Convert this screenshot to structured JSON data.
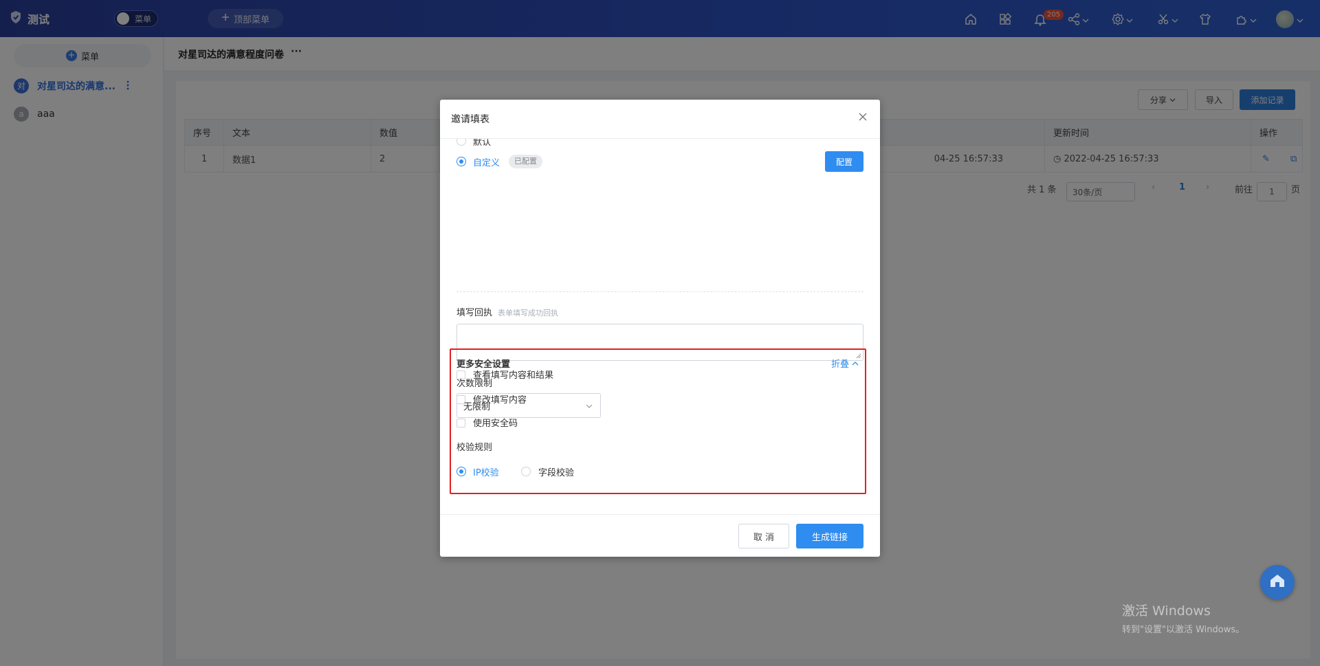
{
  "header": {
    "app_title": "测试",
    "menu_toggle_label": "菜单",
    "top_menu_label": "顶部菜单",
    "notification_count": "205"
  },
  "sidebar": {
    "add_menu_label": "菜单",
    "items": [
      {
        "avatar": "对",
        "label": "对星司达的满意...",
        "active": true
      },
      {
        "avatar": "a",
        "label": "aaa",
        "active": false
      }
    ]
  },
  "page": {
    "title": "对星司达的满意程度问卷"
  },
  "toolbar": {
    "share_label": "分享",
    "import_label": "导入",
    "add_record_label": "添加记录"
  },
  "table": {
    "columns": [
      "序号",
      "文本",
      "数值",
      "更新时间",
      "操作"
    ],
    "rows": [
      {
        "index": "1",
        "text": "数据1",
        "value": "2",
        "created_fragment": "04-25 16:57:33",
        "updated": "2022-04-25 16:57:33"
      }
    ]
  },
  "pagination": {
    "total": "共 1 条",
    "page_size": "30条/页",
    "current_page": "1",
    "goto_label": "前往",
    "goto_value": "1",
    "page_suffix": "页"
  },
  "dialog": {
    "title": "邀请填表",
    "option_default": "默认",
    "option_custom": "自定义",
    "configured_tag": "已配置",
    "configure_button": "配置",
    "receipt_label": "填写回执",
    "receipt_hint": "表单填写成功回执",
    "checkbox_view": "查看填写内容和结果",
    "checkbox_modify": "修改填写内容",
    "checkbox_security_code": "使用安全码",
    "more_security_title": "更多安全设置",
    "collapse_label": "折叠",
    "limit_label": "次数限制",
    "limit_value": "无限制",
    "validation_label": "校验规则",
    "validation_ip": "IP校验",
    "validation_field": "字段校验",
    "cancel_button": "取 消",
    "generate_button": "生成链接"
  },
  "watermark": {
    "line1": "激活 Windows",
    "line2": "转到\"设置\"以激活 Windows。"
  },
  "colors": {
    "header": "#2f52c4",
    "primary": "#2f8cf0",
    "highlight": "#e02020"
  }
}
